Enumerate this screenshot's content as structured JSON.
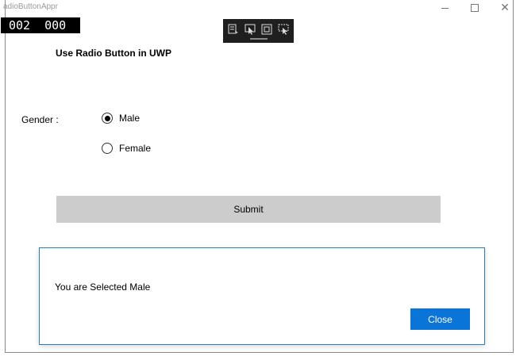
{
  "window": {
    "title": "adioButtonAppr",
    "controls": {
      "minimize": "minimize-icon",
      "maximize": "maximize-icon",
      "close": "✕"
    }
  },
  "frame_counter": {
    "left": "002",
    "right": "000"
  },
  "debug_toolbar": {
    "icons": [
      "live-visual-tree-icon",
      "select-element-icon",
      "layout-adorner-icon",
      "track-focus-icon"
    ]
  },
  "page": {
    "heading": "Use Radio Button in UWP",
    "gender_label": "Gender :",
    "options": [
      {
        "label": "Male",
        "selected": true
      },
      {
        "label": "Female",
        "selected": false
      }
    ],
    "submit_label": "Submit"
  },
  "dialog": {
    "message": "You are Selected Male",
    "close_label": "Close",
    "accent_color": "#0a74d8",
    "border_color": "#2b7fb8"
  }
}
